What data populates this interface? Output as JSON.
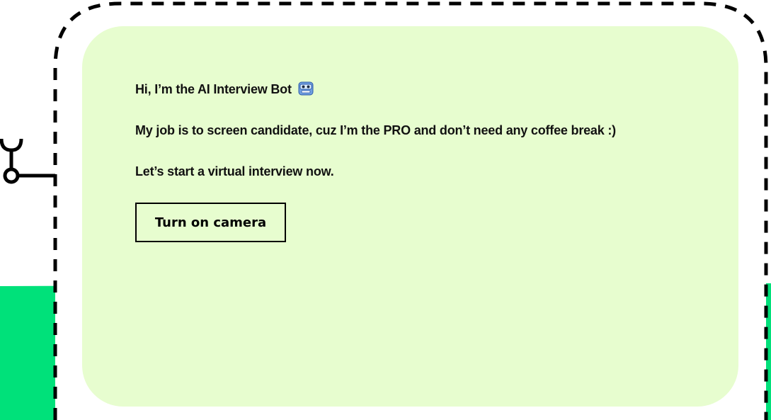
{
  "chat": {
    "greeting": "Hi, I’m the AI Interview Bot",
    "greeting_icon": "robot-face-icon",
    "job_description": "My job is to screen candidate, cuz I’m the PRO and don’t need any coffee break :)",
    "call_to_action": "Let’s start a virtual interview now."
  },
  "actions": {
    "camera_button_label": "Turn on camera"
  },
  "colors": {
    "card_background": "#e7fdcf",
    "accent_green": "#00e17a",
    "text": "#111111",
    "frame": "#000000"
  }
}
